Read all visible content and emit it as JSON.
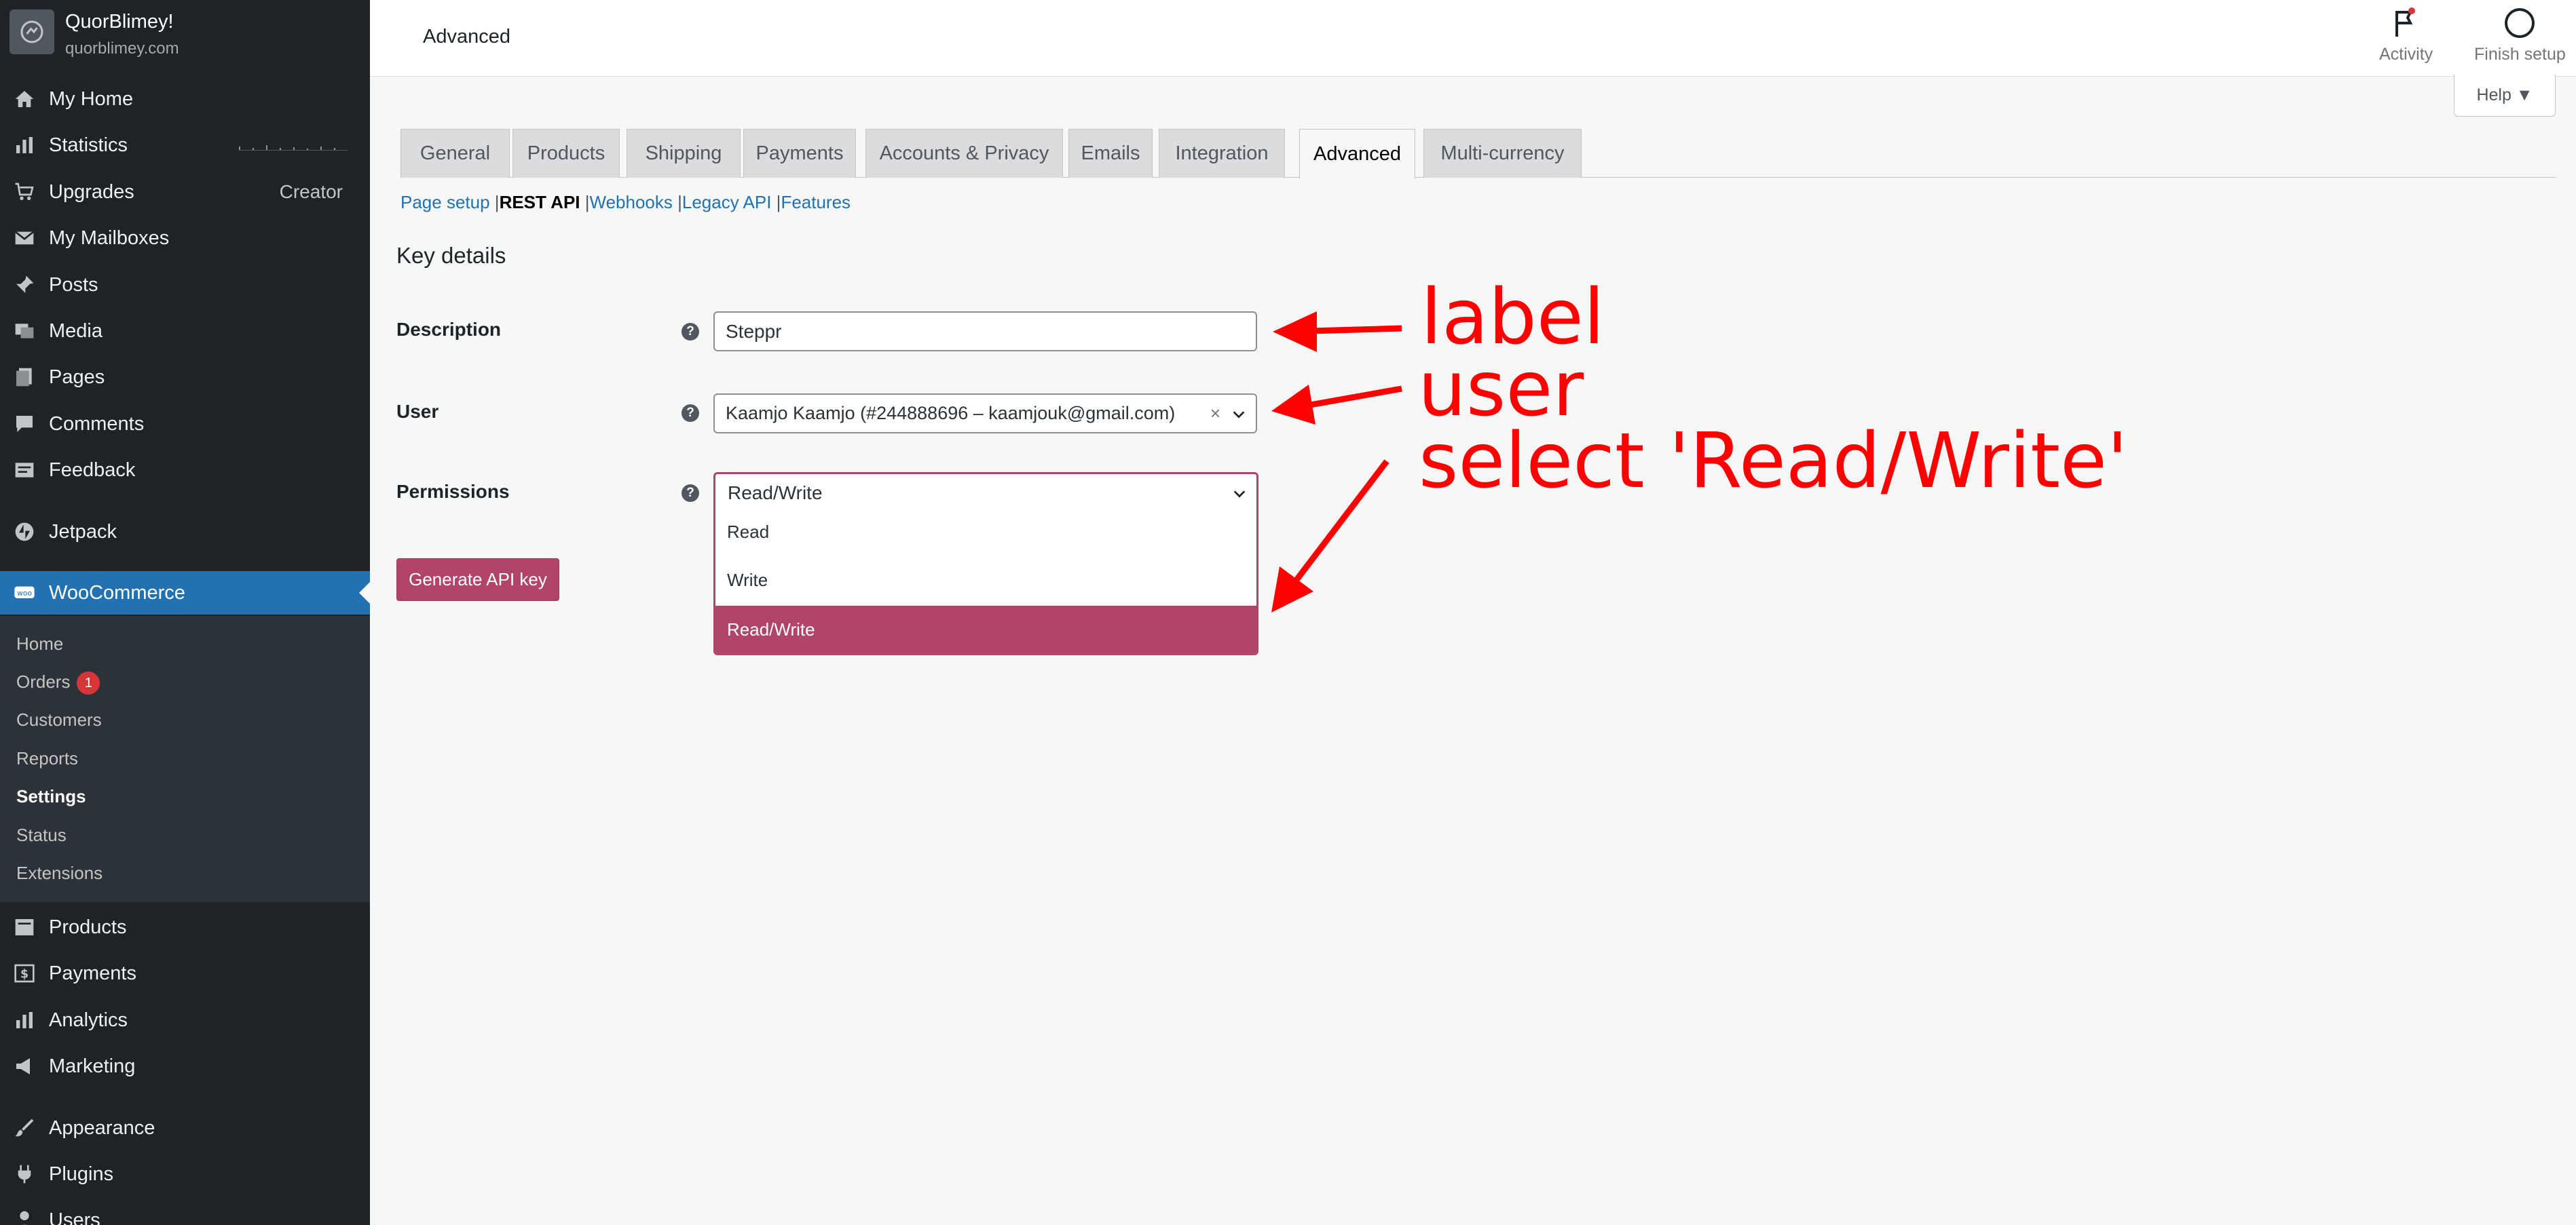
{
  "site": {
    "name": "QuorBlimey!",
    "url": "quorblimey.com"
  },
  "sidebar": {
    "items": [
      {
        "label": "My Home",
        "icon": "home-icon"
      },
      {
        "label": "Statistics",
        "icon": "bar-chart-icon"
      },
      {
        "label": "Upgrades",
        "icon": "cart-icon",
        "right": "Creator"
      },
      {
        "label": "My Mailboxes",
        "icon": "mail-icon"
      },
      {
        "label": "Posts",
        "icon": "pin-icon"
      },
      {
        "label": "Media",
        "icon": "media-icon"
      },
      {
        "label": "Pages",
        "icon": "page-icon"
      },
      {
        "label": "Comments",
        "icon": "comment-icon"
      },
      {
        "label": "Feedback",
        "icon": "feedback-icon"
      },
      {
        "label": "Jetpack",
        "icon": "jetpack-icon"
      },
      {
        "label": "WooCommerce",
        "icon": "woo-icon"
      }
    ],
    "woo_submenu": [
      {
        "label": "Home"
      },
      {
        "label": "Orders",
        "badge": "1"
      },
      {
        "label": "Customers"
      },
      {
        "label": "Reports"
      },
      {
        "label": "Settings"
      },
      {
        "label": "Status"
      },
      {
        "label": "Extensions"
      }
    ],
    "items_after": [
      {
        "label": "Products",
        "icon": "products-icon"
      },
      {
        "label": "Payments",
        "icon": "dollar-icon"
      },
      {
        "label": "Analytics",
        "icon": "analytics-icon"
      },
      {
        "label": "Marketing",
        "icon": "megaphone-icon"
      },
      {
        "label": "Appearance",
        "icon": "brush-icon"
      },
      {
        "label": "Plugins",
        "icon": "plug-icon"
      },
      {
        "label": "Users",
        "icon": "user-icon"
      }
    ]
  },
  "topbar": {
    "title": "Advanced",
    "activity_label": "Activity",
    "finish_label": "Finish setup",
    "help_label": "Help ▼"
  },
  "tabs": [
    "General",
    "Products",
    "Shipping",
    "Payments",
    "Accounts & Privacy",
    "Emails",
    "Integration",
    "Advanced",
    "Multi-currency"
  ],
  "subnav": {
    "page_setup": "Page setup",
    "rest_api": "REST API",
    "webhooks": "Webhooks",
    "legacy_api": "Legacy API",
    "features": "Features"
  },
  "form": {
    "section_title": "Key details",
    "description_label": "Description",
    "description_value": "Steppr",
    "user_label": "User",
    "user_value": "Kaamjo Kaamjo (#244888696 – kaamjouk@gmail.com)",
    "user_clear": "×",
    "permissions_label": "Permissions",
    "permissions_value": "Read/Write",
    "permission_options": [
      "Read",
      "Write",
      "Read/Write"
    ],
    "help_glyph": "?",
    "generate_button": "Generate API key"
  },
  "annotations": {
    "label": "label",
    "user": "user",
    "select": "select 'Read/Write'",
    "color": "#ff0000"
  },
  "colors": {
    "sidebar_bg": "#1d2327",
    "active_blue": "#2271b1",
    "woo_accent": "#b0446b"
  }
}
